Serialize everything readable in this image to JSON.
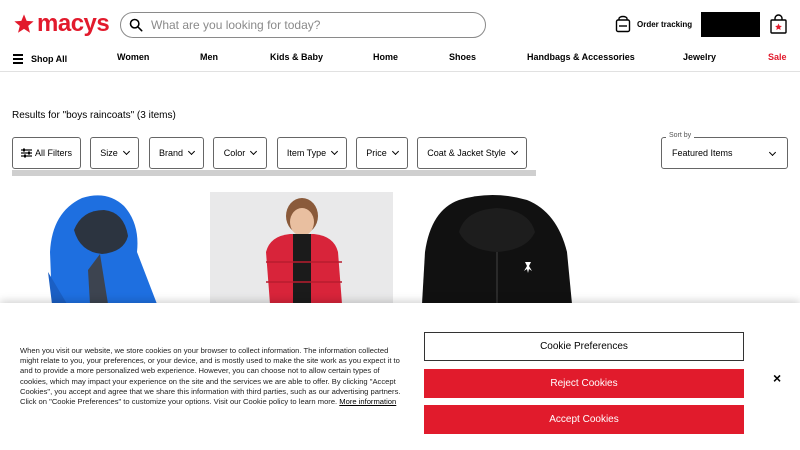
{
  "brand": {
    "name": "macys",
    "color": "#e21a2c"
  },
  "header": {
    "search_placeholder": "What are you looking for today?",
    "order_tracking": "Order tracking"
  },
  "nav": {
    "shop_all": "Shop All",
    "items": [
      "Women",
      "Men",
      "Kids & Baby",
      "Home",
      "Shoes",
      "Handbags & Accessories",
      "Jewelry",
      "Sale"
    ]
  },
  "results": {
    "text": "Results for \"boys raincoats\" (3 items)"
  },
  "filters": [
    "All Filters",
    "Size",
    "Brand",
    "Color",
    "Item Type",
    "Price",
    "Coat & Jacket Style"
  ],
  "sort": {
    "legend": "Sort by",
    "value": "Featured Items"
  },
  "cookie": {
    "text": "When you visit our website, we store cookies on your browser to collect information. The information collected might relate to you, your preferences, or your device, and is mostly used to make the site work as you expect it to and to provide a more personalized web experience. However, you can choose not to allow certain types of cookies, which may impact your experience on the site and the services we are able to offer. By clicking \"Accept Cookies\", you accept and agree that we share this information with third parties, such as our advertising partners. Click on \"Cookie Preferences\" to customize your options. Visit our Cookie policy to learn more.",
    "more_info": "More information",
    "preferences": "Cookie Preferences",
    "reject": "Reject Cookies",
    "accept": "Accept Cookies",
    "close": "×"
  },
  "colors": {
    "accent": "#e11b2c",
    "jacket_blue": "#1e6fe0",
    "jacket_red": "#d8243a",
    "jacket_black": "#111111"
  }
}
